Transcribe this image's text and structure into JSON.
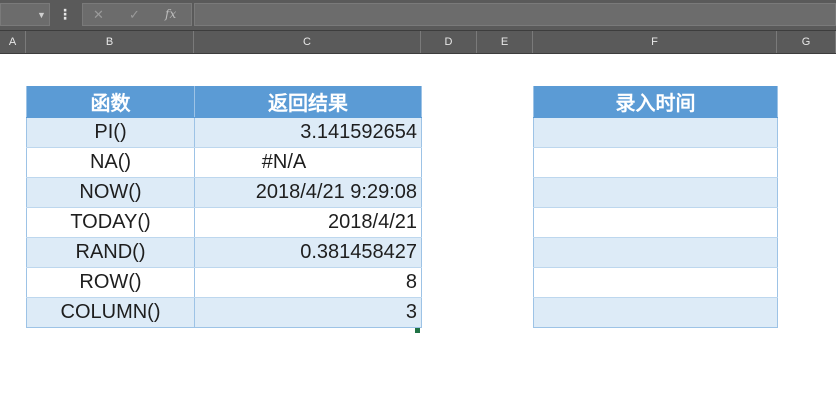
{
  "formula_bar": {
    "name_box": "",
    "formula": "",
    "menu_glyph": "⋮",
    "cancel_glyph": "✕",
    "enter_glyph": "✓",
    "fx_label": "fx"
  },
  "columns": [
    "A",
    "B",
    "C",
    "D",
    "E",
    "F",
    "G"
  ],
  "table1": {
    "headers": [
      "函数",
      "返回结果"
    ],
    "rows": [
      {
        "func": "PI()",
        "result": "3.141592654"
      },
      {
        "func": "NA()",
        "result": "#N/A"
      },
      {
        "func": "NOW()",
        "result": "2018/4/21 9:29:08"
      },
      {
        "func": "TODAY()",
        "result": "2018/4/21"
      },
      {
        "func": "RAND()",
        "result": "0.381458427"
      },
      {
        "func": "ROW()",
        "result": "8"
      },
      {
        "func": "COLUMN()",
        "result": "3"
      }
    ]
  },
  "table2": {
    "header": "录入时间",
    "rows": [
      "",
      "",
      "",
      "",
      "",
      "",
      ""
    ]
  },
  "colors": {
    "header_fill": "#5b9bd5",
    "band_fill": "#ddebf7",
    "border": "#9dc3e6"
  }
}
